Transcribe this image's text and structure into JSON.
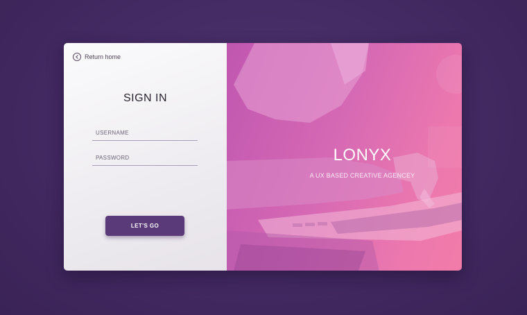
{
  "nav": {
    "return_label": "Return home"
  },
  "form": {
    "title": "SIGN IN",
    "username_placeholder": "USERNAME",
    "password_placeholder": "PASSWORD",
    "submit_label": "LET'S GO"
  },
  "hero": {
    "brand": "LONYX",
    "tagline": "A UX BASED CREATIVE AGENCEY"
  },
  "colors": {
    "background": "#432a62",
    "button": "#5b3a7a",
    "hero_start": "#c057b0",
    "hero_end": "#f27ca8"
  }
}
